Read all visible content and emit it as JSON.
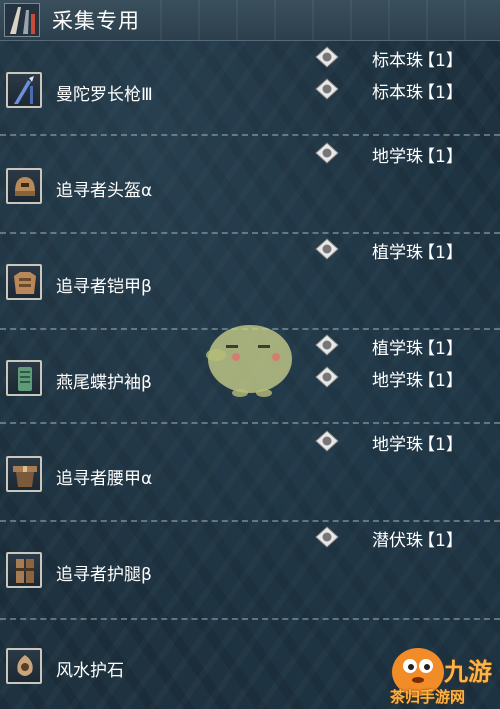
{
  "header": {
    "title": "采集专用"
  },
  "equipment": [
    {
      "name": "曼陀罗长枪Ⅲ",
      "icon": "lance-icon",
      "decorations": [
        {
          "name": "标本珠",
          "count": "【1】"
        },
        {
          "name": "标本珠",
          "count": "【1】"
        }
      ]
    },
    {
      "name": "追寻者头盔α",
      "icon": "helmet-icon",
      "decorations": [
        {
          "name": "地学珠",
          "count": "【1】"
        }
      ]
    },
    {
      "name": "追寻者铠甲β",
      "icon": "chest-armor-icon",
      "decorations": [
        {
          "name": "植学珠",
          "count": "【1】"
        }
      ]
    },
    {
      "name": "燕尾蝶护袖β",
      "icon": "arm-guard-icon",
      "decorations": [
        {
          "name": "植学珠",
          "count": "【1】"
        },
        {
          "name": "地学珠",
          "count": "【1】"
        }
      ]
    },
    {
      "name": "追寻者腰甲α",
      "icon": "waist-armor-icon",
      "decorations": [
        {
          "name": "地学珠",
          "count": "【1】"
        }
      ]
    },
    {
      "name": "追寻者护腿β",
      "icon": "leg-armor-icon",
      "decorations": [
        {
          "name": "潜伏珠",
          "count": "【1】"
        }
      ]
    },
    {
      "name": "风水护石",
      "icon": "charm-icon",
      "decorations": []
    }
  ],
  "watermark": {
    "site": "茶归手游网",
    "brand": "九游"
  }
}
